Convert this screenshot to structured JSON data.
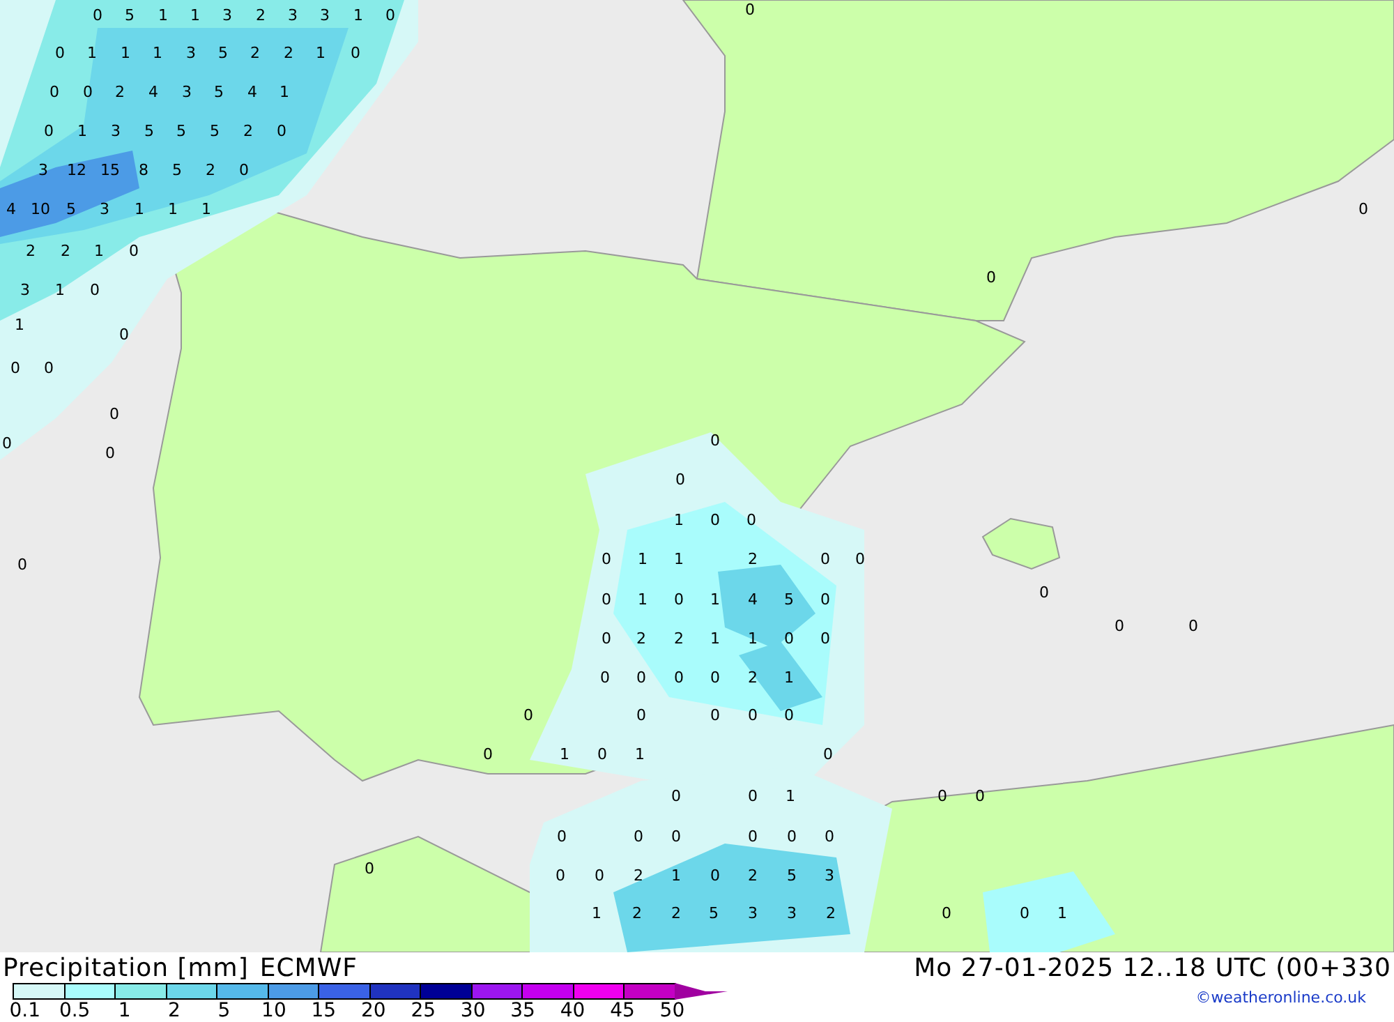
{
  "map": {
    "values": [
      "0",
      "0",
      "5",
      "1",
      "1",
      "3",
      "2",
      "3",
      "3",
      "1",
      "0",
      "0",
      "1",
      "1",
      "1",
      "3",
      "5",
      "2",
      "2",
      "1",
      "0",
      "0",
      "0",
      "2",
      "4",
      "3",
      "5",
      "4",
      "1",
      "0",
      "1",
      "3",
      "5",
      "5",
      "5",
      "2",
      "0",
      "3",
      "12",
      "15",
      "8",
      "5",
      "2",
      "0",
      "4",
      "10",
      "5",
      "3",
      "1",
      "1",
      "1",
      "0",
      "2",
      "2",
      "1",
      "0",
      "0",
      "3",
      "1",
      "0",
      "1",
      "0",
      "0",
      "0",
      "0",
      "0",
      "0",
      "0",
      "0",
      "1",
      "0",
      "0",
      "0",
      "1",
      "1",
      "2",
      "0",
      "0",
      "0",
      "0",
      "0",
      "1",
      "0",
      "1",
      "4",
      "5",
      "0",
      "0",
      "0",
      "0",
      "2",
      "2",
      "1",
      "1",
      "0",
      "0",
      "0",
      "0",
      "0",
      "0",
      "2",
      "1",
      "0",
      "0",
      "0",
      "0",
      "0",
      "0",
      "1",
      "0",
      "1",
      "0",
      "0",
      "0",
      "1",
      "0",
      "0",
      "0",
      "0",
      "0",
      "0",
      "0",
      "0",
      "0",
      "0",
      "0",
      "2",
      "1",
      "0",
      "2",
      "5",
      "3",
      "1",
      "2",
      "2",
      "5",
      "3",
      "3",
      "2",
      "0",
      "0",
      "1"
    ]
  },
  "legend": {
    "title": "Precipitation [mm]",
    "model": "ECMWF",
    "bins": [
      {
        "color": "#d6f8f7"
      },
      {
        "color": "#a9fcfc"
      },
      {
        "color": "#88ebe8"
      },
      {
        "color": "#6cd7ea"
      },
      {
        "color": "#55b9ea"
      },
      {
        "color": "#4c9be6"
      },
      {
        "color": "#3a62e6"
      },
      {
        "color": "#2033c0"
      },
      {
        "color": "#000096"
      },
      {
        "color": "#9c16f0"
      },
      {
        "color": "#c400f0"
      },
      {
        "color": "#f000f0"
      },
      {
        "color": "#c400c4"
      }
    ],
    "ticks": [
      "0.1",
      "0.5",
      "1",
      "2",
      "5",
      "10",
      "15",
      "20",
      "25",
      "30",
      "35",
      "40",
      "45",
      "50"
    ]
  },
  "valid_time": "Mo 27-01-2025 12..18 UTC (00+330",
  "credit": "©weatheronline.co.uk"
}
